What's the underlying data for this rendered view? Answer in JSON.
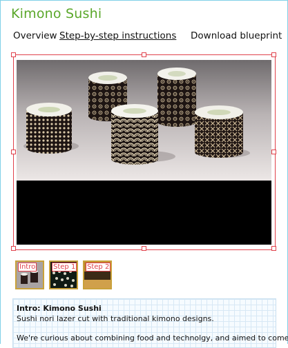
{
  "page": {
    "title": "Kimono Sushi"
  },
  "nav": {
    "overview": "Overview",
    "steps": "Step-by-step instructions",
    "download": "Download blueprint"
  },
  "thumbnails": [
    {
      "label": "Intro"
    },
    {
      "label": "Step 1"
    },
    {
      "label": "Step 2"
    }
  ],
  "description": {
    "title": "Intro: Kimono Sushi",
    "subtitle": "Sushi nori lazer cut with traditional kimono designs.",
    "body": "We're curious about combining food and technolgy,  and aimed to come up"
  },
  "colors": {
    "title": "#5aa72a",
    "selection": "#e0404a",
    "frame": "#7fd0e8"
  }
}
